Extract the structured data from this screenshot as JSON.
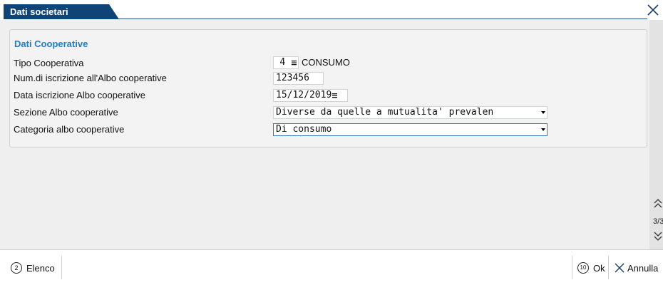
{
  "window": {
    "title": "Dati societari",
    "close_icon": "close-icon"
  },
  "panel": {
    "title": "Dati Cooperative",
    "rows": [
      {
        "label": "Tipo Cooperativa"
      },
      {
        "label": "Num.di iscrizione all'Albo cooperative"
      },
      {
        "label": "Data iscrizione Albo cooperative"
      },
      {
        "label": "Sezione Albo cooperative"
      },
      {
        "label": "Categoria albo cooperative"
      }
    ]
  },
  "fields": {
    "tipo_code": "4",
    "tipo_desc": "CONSUMO",
    "num_iscrizione": "123456",
    "data_iscrizione": "15/12/2019",
    "sezione": "Diverse da quelle a mutualita' prevalen",
    "categoria": "Di consumo"
  },
  "scroll": {
    "page_indicator": "3/3"
  },
  "footer": {
    "elenco": {
      "key": "2",
      "label": "Elenco"
    },
    "ok": {
      "key": "10",
      "label": "Ok"
    },
    "annulla": {
      "label": "Annulla"
    }
  }
}
